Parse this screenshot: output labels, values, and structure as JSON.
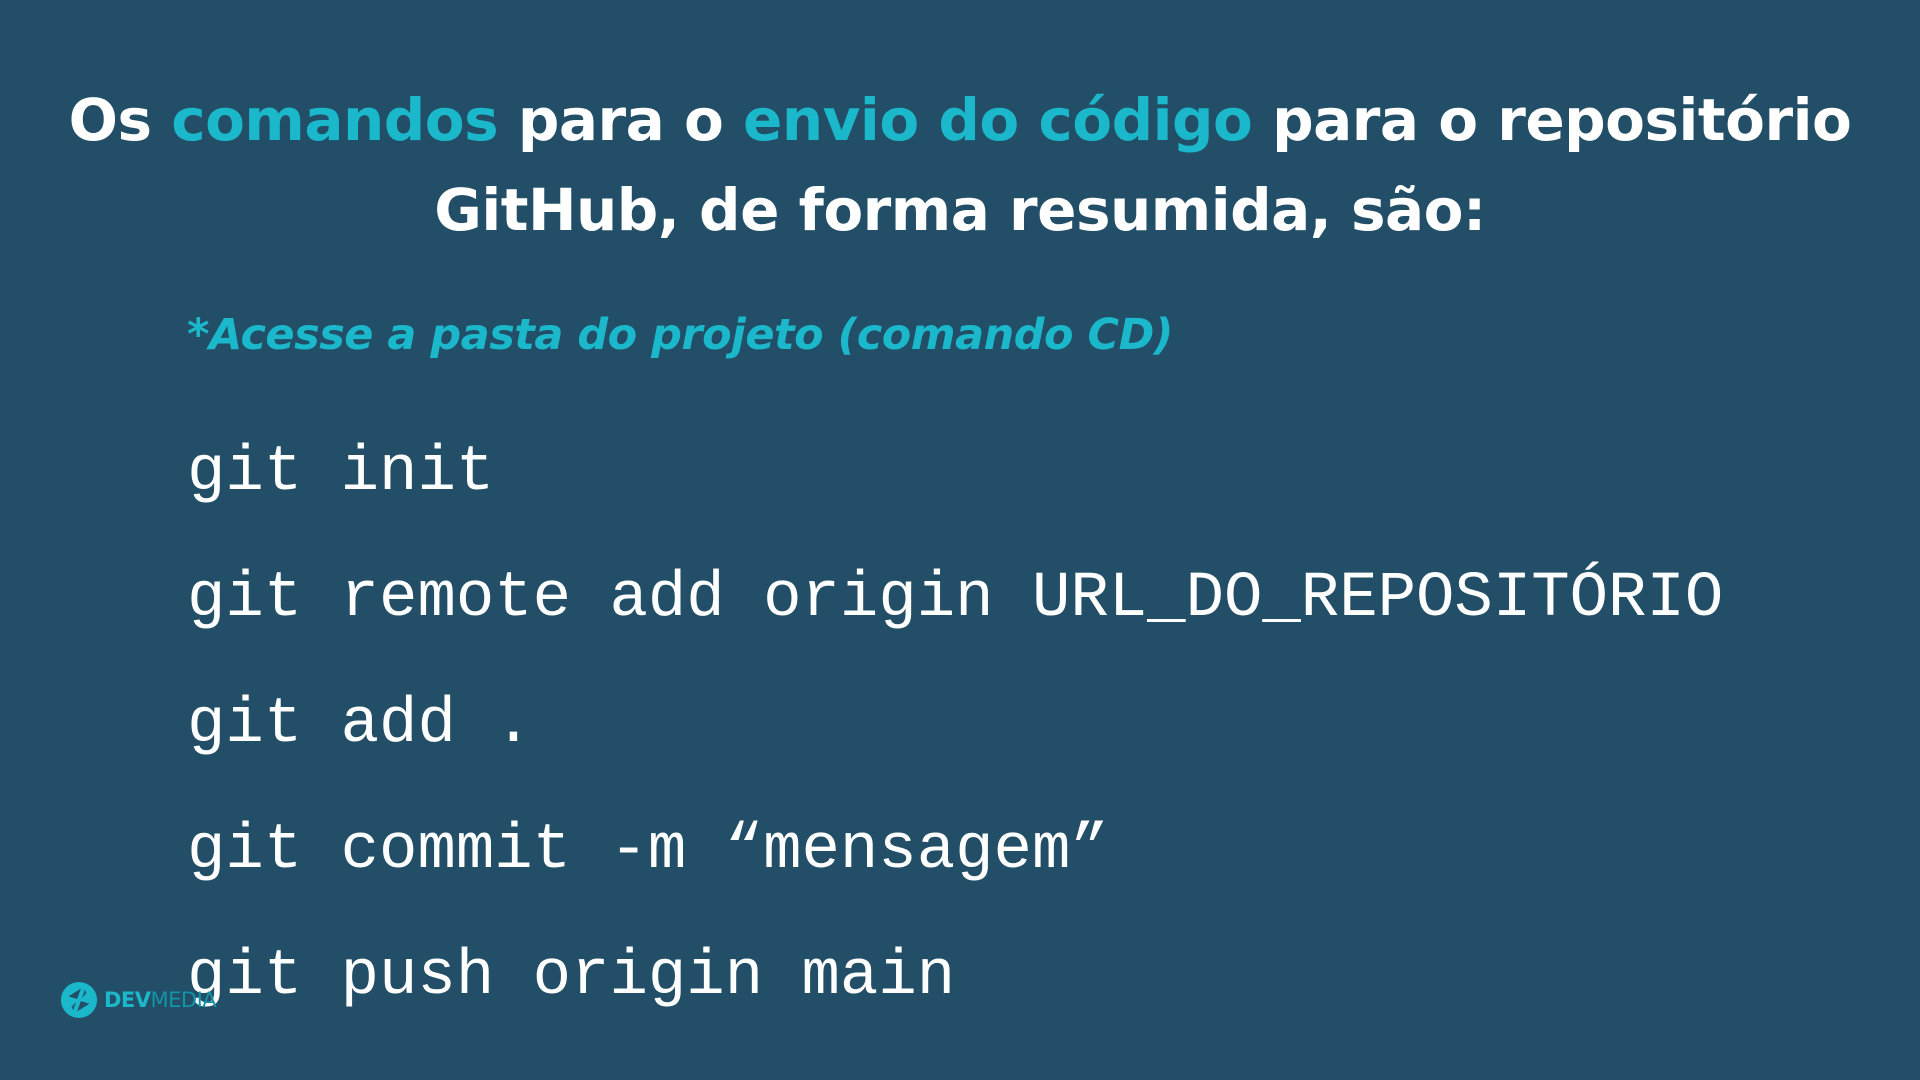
{
  "title": {
    "part1": "Os ",
    "accent1": "comandos",
    "part2": " para o ",
    "accent2": "envio do código",
    "part3": " para o repositório GitHub, de forma resumida, são:"
  },
  "subtitle": "*Acesse a pasta do projeto (comando CD)",
  "commands": [
    "git init",
    "git remote add origin URL_DO_REPOSITÓRIO",
    "git add .",
    "git commit -m “mensagem”",
    "git push origin main"
  ],
  "logo": {
    "icon": "devmedia-logo-icon",
    "text_bold": "DEV",
    "text_light": "MEDIA"
  },
  "colors": {
    "background": "#224f67",
    "accent": "#1bb8cb",
    "text": "#ffffff"
  }
}
